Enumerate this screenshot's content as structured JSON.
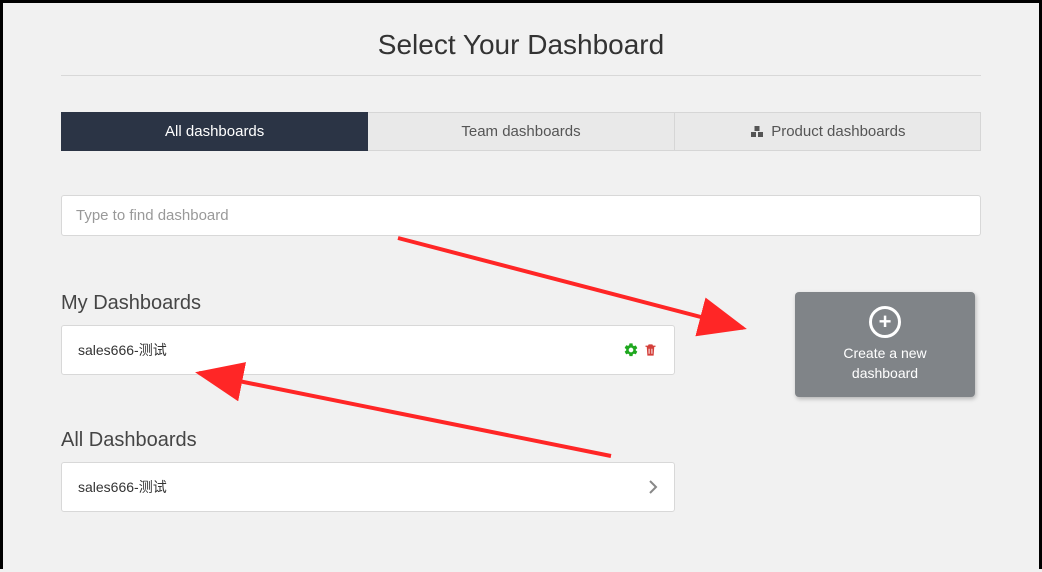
{
  "title": "Select Your Dashboard",
  "tabs": {
    "all": "All dashboards",
    "team": "Team dashboards",
    "product": "Product dashboards"
  },
  "search": {
    "placeholder": "Type to find dashboard"
  },
  "sections": {
    "my": "My Dashboards",
    "all": "All Dashboards"
  },
  "my_dashboards": [
    {
      "name": "sales666-测试"
    }
  ],
  "all_dashboards": [
    {
      "name": "sales666-测试"
    }
  ],
  "create": {
    "label_line1": "Create a new",
    "label_line2": "dashboard"
  }
}
